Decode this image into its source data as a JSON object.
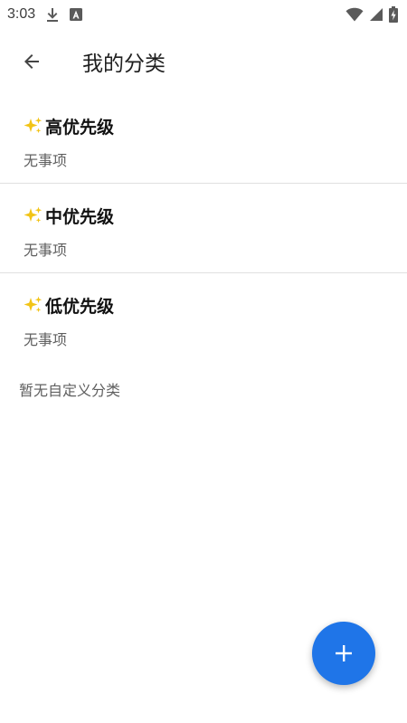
{
  "status_bar": {
    "time": "3:03",
    "icons": [
      "download-icon",
      "app-notification-icon",
      "wifi-icon",
      "cell-signal-icon",
      "battery-charging-icon"
    ]
  },
  "app_bar": {
    "back_icon": "arrow-back-icon",
    "title": "我的分类"
  },
  "categories": [
    {
      "icon": "sparkles-icon",
      "name": "高优先级",
      "count_text": "无事项"
    },
    {
      "icon": "sparkles-icon",
      "name": "中优先级",
      "count_text": "无事项"
    },
    {
      "icon": "sparkles-icon",
      "name": "低优先级",
      "count_text": "无事项"
    }
  ],
  "empty_custom_note": "暂无自定义分类",
  "fab": {
    "icon": "plus-icon"
  },
  "colors": {
    "accent": "#1f75e8",
    "sparkle": "#f2c417",
    "divider": "#e0e0e0",
    "secondary_text": "#5f5f5f"
  }
}
